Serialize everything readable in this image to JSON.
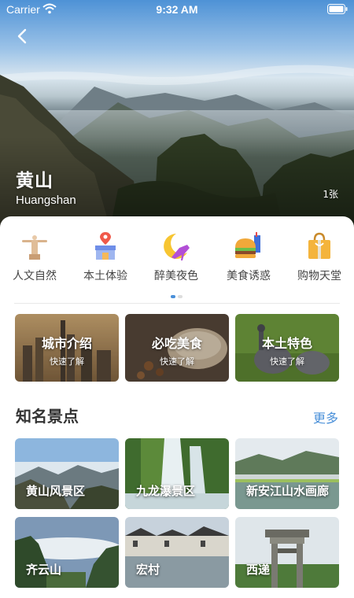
{
  "status_bar": {
    "carrier": "Carrier",
    "time": "9:32 AM"
  },
  "header": {
    "title_zh": "黄山",
    "title_en": "Huangshan",
    "photo_count": "1张"
  },
  "categories": [
    {
      "label": "人文自然",
      "icon": "statue-icon"
    },
    {
      "label": "本土体验",
      "icon": "shop-icon"
    },
    {
      "label": "醉美夜色",
      "icon": "moon-heel-icon"
    },
    {
      "label": "美食诱惑",
      "icon": "burger-icon"
    },
    {
      "label": "购物天堂",
      "icon": "shopping-bag-icon"
    }
  ],
  "pager": {
    "pages": 2,
    "current": 1,
    "active_color": "#4a90d9",
    "inactive_color": "#dddddd"
  },
  "features": [
    {
      "title": "城市介绍",
      "subtitle": "快速了解"
    },
    {
      "title": "必吃美食",
      "subtitle": "快速了解"
    },
    {
      "title": "本土特色",
      "subtitle": "快速了解"
    }
  ],
  "section": {
    "title": "知名景点",
    "more": "更多"
  },
  "spots": [
    {
      "name": "黄山风景区"
    },
    {
      "name": "九龙瀑景区"
    },
    {
      "name": "新安江山水画廊"
    },
    {
      "name": "齐云山"
    },
    {
      "name": "宏村"
    },
    {
      "name": "西递"
    }
  ],
  "colors": {
    "accent": "#4a90d9",
    "text": "#333333"
  }
}
